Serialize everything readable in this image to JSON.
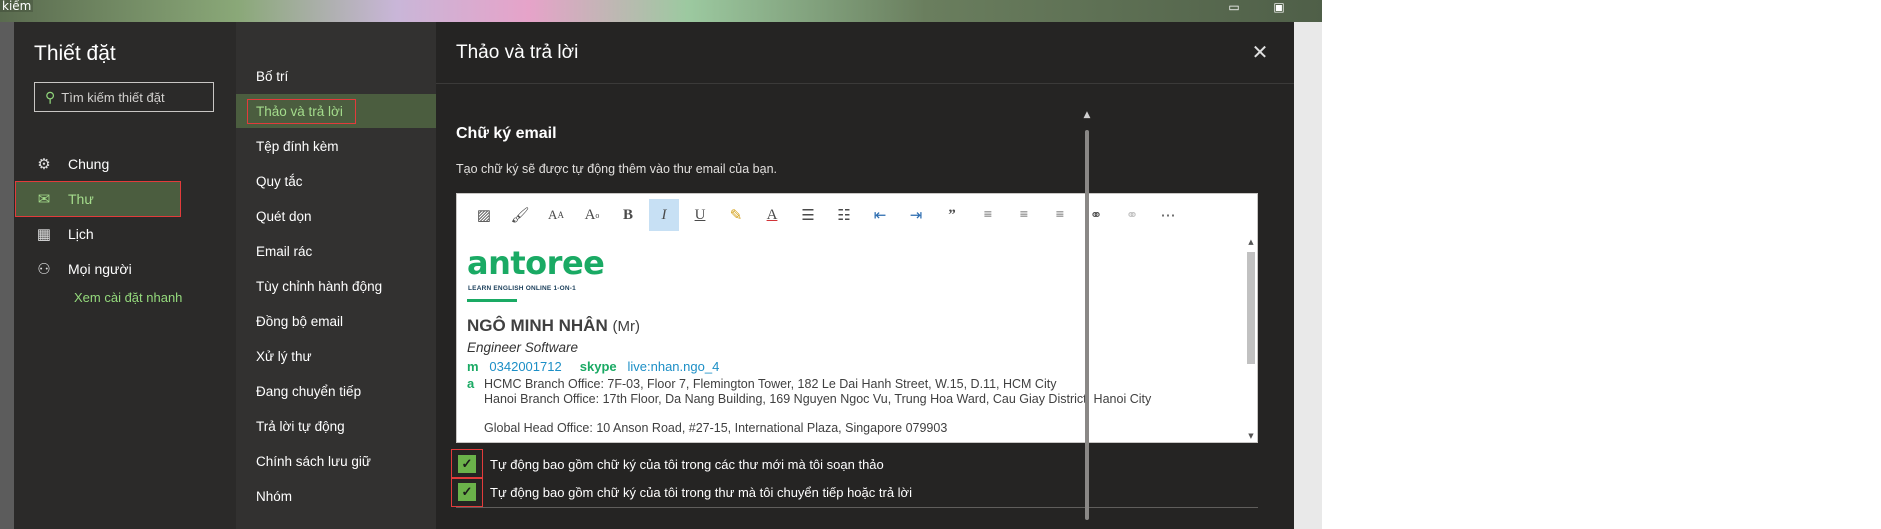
{
  "background": {
    "search_fragment": "kiếm"
  },
  "settings": {
    "title": "Thiết đặt",
    "search_placeholder": "Tìm kiếm thiết đặt",
    "categories": [
      {
        "label": "Chung",
        "icon": "gear-icon"
      },
      {
        "label": "Thư",
        "icon": "mail-icon",
        "active": true
      },
      {
        "label": "Lịch",
        "icon": "calendar-icon"
      },
      {
        "label": "Mọi người",
        "icon": "people-icon"
      }
    ],
    "quick_settings_link": "Xem cài đặt nhanh"
  },
  "mail_nav": {
    "items": [
      "Bố trí",
      "Thảo và trả lời",
      "Tệp đính kèm",
      "Quy tắc",
      "Quét dọn",
      "Email rác",
      "Tùy chỉnh hành động",
      "Đồng bộ email",
      "Xử lý thư",
      "Đang chuyển tiếp",
      "Trả lời tự động",
      "Chính sách lưu giữ",
      "Nhóm"
    ],
    "active_index": 1
  },
  "content": {
    "title": "Thảo và trả lời",
    "close_icon": "close-icon",
    "section_title": "Chữ ký email",
    "section_description": "Tạo chữ ký sẽ được tự động thêm vào thư email của bạn.",
    "toolbar_icons": [
      "insert-image-icon",
      "format-painter-icon",
      "font-size-icon",
      "superscript-icon",
      "bold-icon",
      "italic-icon",
      "underline-icon",
      "highlight-icon",
      "font-color-icon",
      "bullets-icon",
      "numbering-icon",
      "decrease-indent-icon",
      "increase-indent-icon",
      "quote-icon",
      "align-left-icon",
      "align-center-icon",
      "align-right-icon",
      "link-icon",
      "unlink-icon",
      "more-icon"
    ],
    "signature": {
      "logo_text": "antoree",
      "logo_tagline": "LEARN ENGLISH ONLINE 1-ON-1",
      "name": "NGÔ MINH NHÂN",
      "name_suffix": "(Mr)",
      "role": "Engineer Software",
      "phone_label": "m",
      "phone": "0342001712",
      "skype_label": "skype",
      "skype": "live:nhan.ngo_4",
      "address_label": "a",
      "addresses": [
        "HCMC Branch Office: 7F-03, Floor 7, Flemington Tower, 182 Le Dai Hanh Street, W.15, D.11, HCM City",
        "Hanoi Branch Office: 17th Floor, Da Nang Building, 169 Nguyen Ngoc Vu, Trung Hoa Ward, Cau Giay District, Hanoi City",
        "Global Head Office: 10 Anson Road, #27-15, International Plaza, Singapore 079903"
      ]
    },
    "checkboxes": [
      {
        "label": "Tự động bao gồm chữ ký của tôi trong các thư mới mà tôi soạn thảo",
        "checked": true
      },
      {
        "label": "Tự động bao gồm chữ ký của tôi trong thư mà tôi chuyển tiếp hoặc trả lời",
        "checked": true
      }
    ]
  },
  "colors": {
    "accent_green": "#a4dc8c",
    "active_bg": "#4b5d3f",
    "brand_green": "#1aaa64",
    "highlight_red": "#e23b3b"
  }
}
